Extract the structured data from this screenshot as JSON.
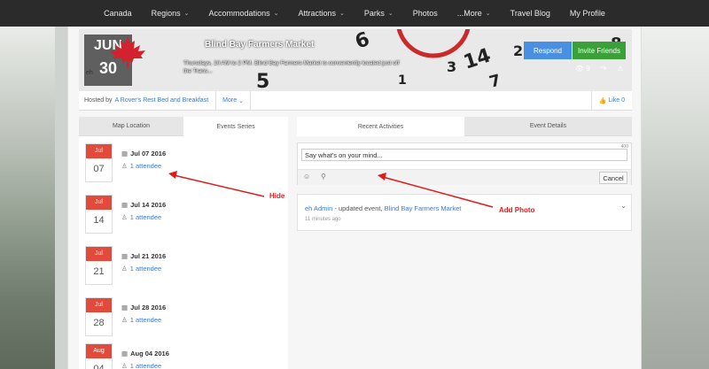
{
  "nav": {
    "items": [
      {
        "label": "Canada",
        "dropdown": false
      },
      {
        "label": "Regions",
        "dropdown": true
      },
      {
        "label": "Accommodations",
        "dropdown": true
      },
      {
        "label": "Attractions",
        "dropdown": true
      },
      {
        "label": "Parks",
        "dropdown": true
      },
      {
        "label": "Photos",
        "dropdown": false
      },
      {
        "label": "...More",
        "dropdown": true
      },
      {
        "label": "Travel Blog",
        "dropdown": false
      },
      {
        "label": "My Profile",
        "dropdown": false
      }
    ]
  },
  "event": {
    "month": "JUN",
    "day": "30",
    "org_logo_text": "eh",
    "title": "Blind Bay Farmers Market",
    "description": "Thursdays, 10 AM to 2 PM. Blind Bay Farmers Market is conveniently located just off the Trans...",
    "respond_label": "Respond",
    "invite_label": "Invite Friends",
    "views": "9"
  },
  "hosted": {
    "prefix": "Hosted by",
    "host": "A Rover's Rest Bed and Breakfast",
    "more_label": "More",
    "like_label": "Like 0"
  },
  "left_tabs": [
    "Map Location",
    "Events Series"
  ],
  "series": [
    {
      "month": "Jul",
      "day": "07",
      "date": "Jul 07 2016",
      "attendees": "1 attendee"
    },
    {
      "month": "Jul",
      "day": "14",
      "date": "Jul 14 2016",
      "attendees": "1 attendee"
    },
    {
      "month": "Jul",
      "day": "21",
      "date": "Jul 21 2016",
      "attendees": "1 attendee"
    },
    {
      "month": "Jul",
      "day": "28",
      "date": "Jul 28 2016",
      "attendees": "1 attendee"
    },
    {
      "month": "Aug",
      "day": "04",
      "date": "Aug 04 2016",
      "attendees": "1 attendee"
    }
  ],
  "right_tabs": [
    "Recent Activities",
    "Event Details"
  ],
  "composer": {
    "placeholder": "Say what's on your mind...",
    "char_count": "400",
    "cancel_label": "Cancel"
  },
  "activity": {
    "user": "eh Admin",
    "action": " - updated event, ",
    "event": "Blind Bay Farmers Market",
    "time": "11 minutes ago"
  },
  "annotations": {
    "hide": "Hide",
    "add_photo": "Add Photo"
  },
  "colors": {
    "nav_bg": "#2b2b2b",
    "respond": "#4a90e2",
    "invite": "#3aa13a",
    "calendar_red": "#e24b3b",
    "link_blue": "#3a7bd5",
    "annotation_red": "#e01b1b"
  }
}
